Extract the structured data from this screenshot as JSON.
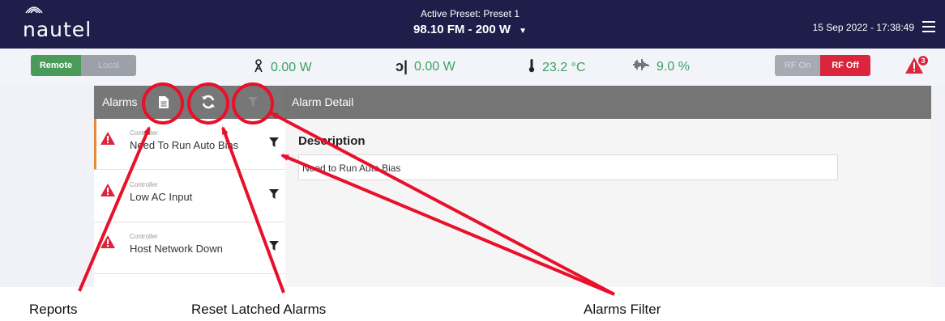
{
  "header": {
    "logo": "nautel",
    "preset_label": "Active Preset: Preset 1",
    "preset_value": "98.10 FM - 200 W",
    "datetime": "15 Sep 2022 - 17:38:49"
  },
  "status": {
    "remote_label": "Remote",
    "local_label": "Local",
    "forward_power": "0.00 W",
    "reflected_power": "0.00 W",
    "temperature": "23.2 °C",
    "modulation": "9.0 %",
    "rf_on_label": "RF On",
    "rf_off_label": "RF Off",
    "alarm_count": "3"
  },
  "alarms_panel": {
    "title": "Alarms",
    "items": [
      {
        "category": "Controller",
        "name": "Need To Run Auto Bias"
      },
      {
        "category": "Controller",
        "name": "Low AC Input"
      },
      {
        "category": "Controller",
        "name": "Host Network Down"
      }
    ]
  },
  "detail_panel": {
    "title": "Alarm Detail",
    "description_label": "Description",
    "description_value": "Need to Run Auto Bias"
  },
  "annotations": {
    "reports": "Reports",
    "reset": "Reset Latched Alarms",
    "filter": "Alarms Filter"
  },
  "colors": {
    "topbar": "#1d1f4a",
    "accent_green": "#3aa35e",
    "rf_off_red": "#d9263d",
    "annotation_red": "#e8102a",
    "selected_border": "#e8893a"
  },
  "icons": [
    "nautel-logo-icon",
    "chevron-down-icon",
    "hamburger-menu-icon",
    "antenna-icon",
    "reflected-power-icon",
    "thermometer-icon",
    "waveform-icon",
    "alarm-badge-icon",
    "report-icon",
    "refresh-icon",
    "filter-icon",
    "warning-icon"
  ]
}
